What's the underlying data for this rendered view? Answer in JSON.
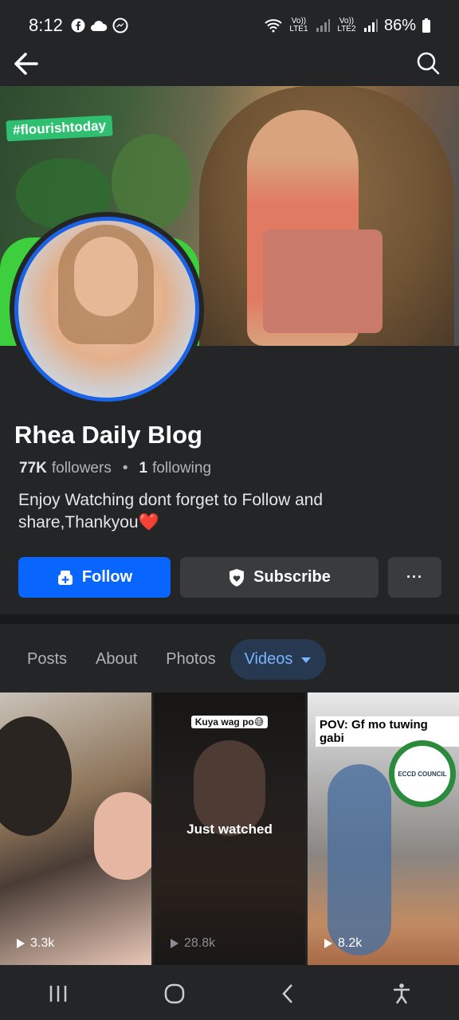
{
  "status_bar": {
    "time": "8:12",
    "sim1": "Vo)) LTE1",
    "sim2": "Vo)) LTE2",
    "battery": "86%"
  },
  "profile": {
    "name": "Rhea Daily Blog",
    "followers_count": "77K",
    "followers_label": "followers",
    "following_count": "1",
    "following_label": "following",
    "bio": "Enjoy Watching dont forget to Follow and share,Thankyou❤️"
  },
  "cover": {
    "tag": "#flourishtoday"
  },
  "actions": {
    "follow": "Follow",
    "subscribe": "Subscribe",
    "more": "···"
  },
  "tabs": [
    {
      "label": "Posts"
    },
    {
      "label": "About"
    },
    {
      "label": "Photos"
    },
    {
      "label": "Videos"
    }
  ],
  "videos": [
    {
      "views": "3.3k"
    },
    {
      "views": "28.8k",
      "overlay_top": "Kuya wag po😅",
      "status": "Just watched"
    },
    {
      "views": "8.2k",
      "overlay_top": "POV: Gf mo tuwing gabi",
      "badge": "ECCD COUNCIL"
    }
  ],
  "colors": {
    "background": "#242526",
    "primary": "#0866ff",
    "secondary_button": "#3a3b3c",
    "active_tab_bg": "#263951",
    "active_tab_text": "#7ab3ff",
    "avatar_ring": "#1b63e6"
  },
  "icons": {
    "back": "arrow-left-icon",
    "search": "search-icon",
    "follow": "follow-icon",
    "subscribe": "shield-heart-icon",
    "dropdown": "caret-down-icon",
    "play": "play-icon"
  }
}
